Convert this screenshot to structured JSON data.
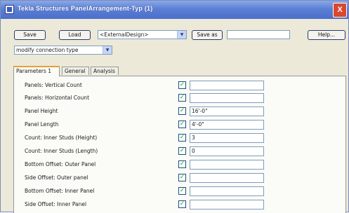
{
  "window": {
    "title": "Tekla Structures  PanelArrangement-Typ  (1)",
    "close_glyph": "X"
  },
  "toolbar": {
    "save_label": "Save",
    "load_label": "Load",
    "preset_value": "<ExternalDesign>",
    "save_as_label": "Save as",
    "save_as_value": "",
    "help_label": "Help..."
  },
  "mode_select": {
    "value": "modify connection type"
  },
  "tabs": [
    {
      "label": "Parameters 1",
      "active": true
    },
    {
      "label": "General",
      "active": false
    },
    {
      "label": "Analysis",
      "active": false
    }
  ],
  "parameters": [
    {
      "label": "Panels: Vertical Count",
      "checked": true,
      "value": ""
    },
    {
      "label": "Panels: Horizontal Count",
      "checked": true,
      "value": ""
    },
    {
      "label": "Panel Height",
      "checked": true,
      "value": "16'-0\""
    },
    {
      "label": "Panel Length",
      "checked": true,
      "value": "4'-0\""
    },
    {
      "label": "Count: Inner Studs (Height)",
      "checked": true,
      "value": "3"
    },
    {
      "label": "Count: Inner Studs (Length)",
      "checked": true,
      "value": "0"
    },
    {
      "label": "Bottom Offset: Outer Panel",
      "checked": true,
      "value": ""
    },
    {
      "label": "Side Offset: Outer panel",
      "checked": true,
      "value": ""
    },
    {
      "label": "Bottom Offset: Inner Panel",
      "checked": true,
      "value": ""
    },
    {
      "label": "Side Offset: Inner Panel",
      "checked": true,
      "value": ""
    }
  ],
  "icons": {
    "dropdown": "chevron-down-icon",
    "check": "check-icon",
    "app": "app-icon",
    "close": "close-icon"
  },
  "colors": {
    "titlebar": "#5c7fd4",
    "close_button": "#d9472e",
    "active_tab_accent": "#e7a03a",
    "dialog_bg": "#ece9d8",
    "check_mark": "#21a121"
  }
}
